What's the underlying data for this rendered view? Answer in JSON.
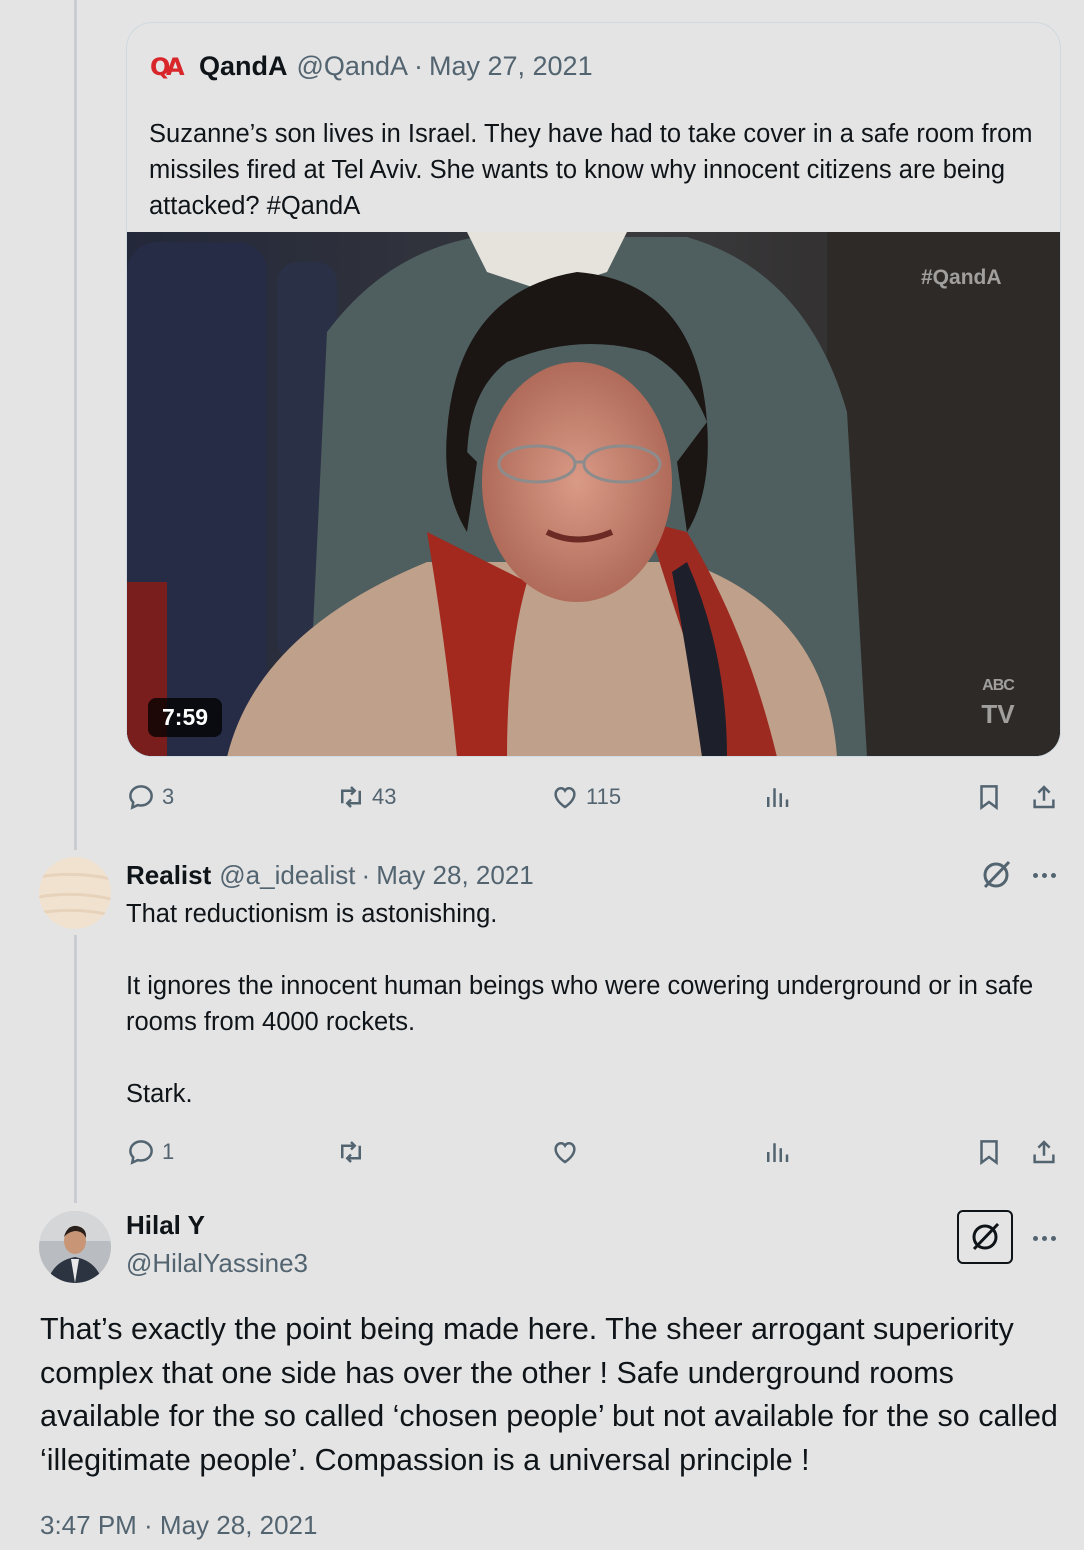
{
  "quoted_tweet": {
    "name": "QandA",
    "handle": "@QandA",
    "separator": "·",
    "date": "May 27, 2021",
    "logo_text": "QA",
    "text": "Suzanne’s son lives in Israel. They have had to take cover in a safe room from missiles fired at Tel Aviv. She wants to know why innocent citizens are being attacked? #QandA",
    "video": {
      "duration": "7:59",
      "watermark": "#QandA",
      "channel_logo_top": "ABC",
      "channel_logo_bottom": "TV"
    },
    "stats": {
      "replies": "3",
      "retweets": "43",
      "likes": "115"
    }
  },
  "reply_tweet": {
    "name": "Realist",
    "handle": "@a_idealist",
    "separator": "·",
    "date": "May 28, 2021",
    "paragraphs": [
      "That reductionism is astonishing.",
      "It ignores the innocent human beings who were cowering underground or in safe rooms from 4000 rockets.",
      "Stark."
    ],
    "stats": {
      "replies": "1",
      "retweets": "",
      "likes": ""
    }
  },
  "main_tweet": {
    "name": "Hilal Y",
    "handle": "@HilalYassine3",
    "text": "That’s exactly the point being made here. The sheer arrogant superiority complex that one side has over the other ! Safe underground rooms available for the so called ‘chosen people’ but not available for the so called ‘illegitimate people’. Compassion is a universal principle !",
    "timestamp": "3:47 PM · May 28, 2021"
  },
  "colors": {
    "background": "#e4e4e4",
    "text": "#0f1419",
    "muted": "#536471",
    "qa_brand": "#d8262b"
  },
  "icons": [
    "reply-icon",
    "retweet-icon",
    "like-icon",
    "views-icon",
    "bookmark-icon",
    "share-icon",
    "grok-icon",
    "more-icon"
  ]
}
